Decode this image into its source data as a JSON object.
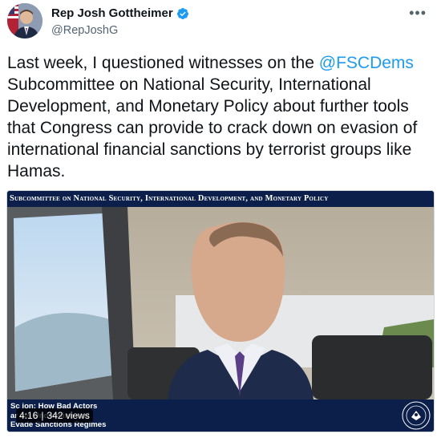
{
  "author": {
    "name": "Rep Josh Gottheimer",
    "handle": "@RepJoshG",
    "verified": true
  },
  "tweet": {
    "text_before": "Last week, I questioned witnesses on the ",
    "mention": "@FSCDems",
    "text_after": " Subcommittee on National Security, International Development, and Monetary Policy about further tools that Congress can provide to crack down on evasion of international financial sanctions by terrorist groups like Hamas."
  },
  "video": {
    "banner": "Subcommittee on National Security, International Development, and Monetary Policy",
    "lower_third_line1": "Sc      ion: How Bad Actors",
    "lower_third_line2": "ar                  nts Undermine and",
    "lower_third_line3": "Evade Sanctions Regimes",
    "duration": "4:16",
    "views": "342 views"
  },
  "icons": {
    "verified": "verified-badge-icon",
    "more": "more-options-icon",
    "seal": "congress-seal-icon"
  },
  "colors": {
    "accent": "#1d9bf0",
    "banner_bg": "#0b1f4a",
    "text": "#0f1419",
    "muted": "#536471"
  }
}
